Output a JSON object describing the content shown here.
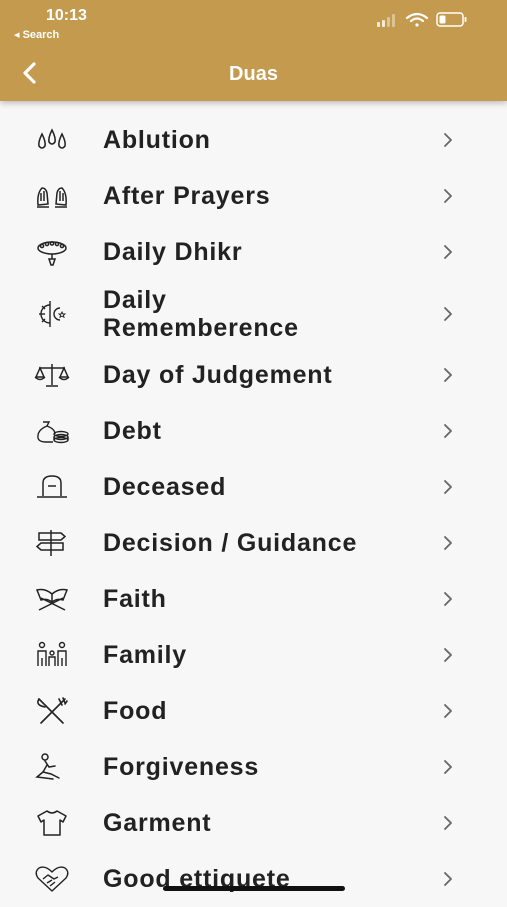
{
  "status": {
    "time": "10:13",
    "back_app": "◂ Search"
  },
  "header": {
    "title": "Duas"
  },
  "list": {
    "items": [
      {
        "label": "Ablution",
        "icon": "water-drops-icon"
      },
      {
        "label": "After Prayers",
        "icon": "praying-hands-icon"
      },
      {
        "label": "Daily Dhikr",
        "icon": "prayer-beads-icon"
      },
      {
        "label_line1": "Daily",
        "label_line2": "Rememberence",
        "icon": "sun-moon-icon"
      },
      {
        "label": "Day of Judgement",
        "icon": "scales-icon"
      },
      {
        "label": "Debt",
        "icon": "money-bag-icon"
      },
      {
        "label": "Deceased",
        "icon": "gravestone-icon"
      },
      {
        "label": "Decision / Guidance",
        "icon": "signpost-icon"
      },
      {
        "label": "Faith",
        "icon": "quran-stand-icon"
      },
      {
        "label": "Family",
        "icon": "family-icon"
      },
      {
        "label": "Food",
        "icon": "fork-knife-icon"
      },
      {
        "label": "Forgiveness",
        "icon": "kneeling-person-icon"
      },
      {
        "label": "Garment",
        "icon": "shirt-icon"
      },
      {
        "label": "Good ettiquete",
        "icon": "handshake-heart-icon"
      }
    ]
  },
  "colors": {
    "header": "#c49a4e",
    "background": "#f7f7f7",
    "text": "#222222"
  }
}
